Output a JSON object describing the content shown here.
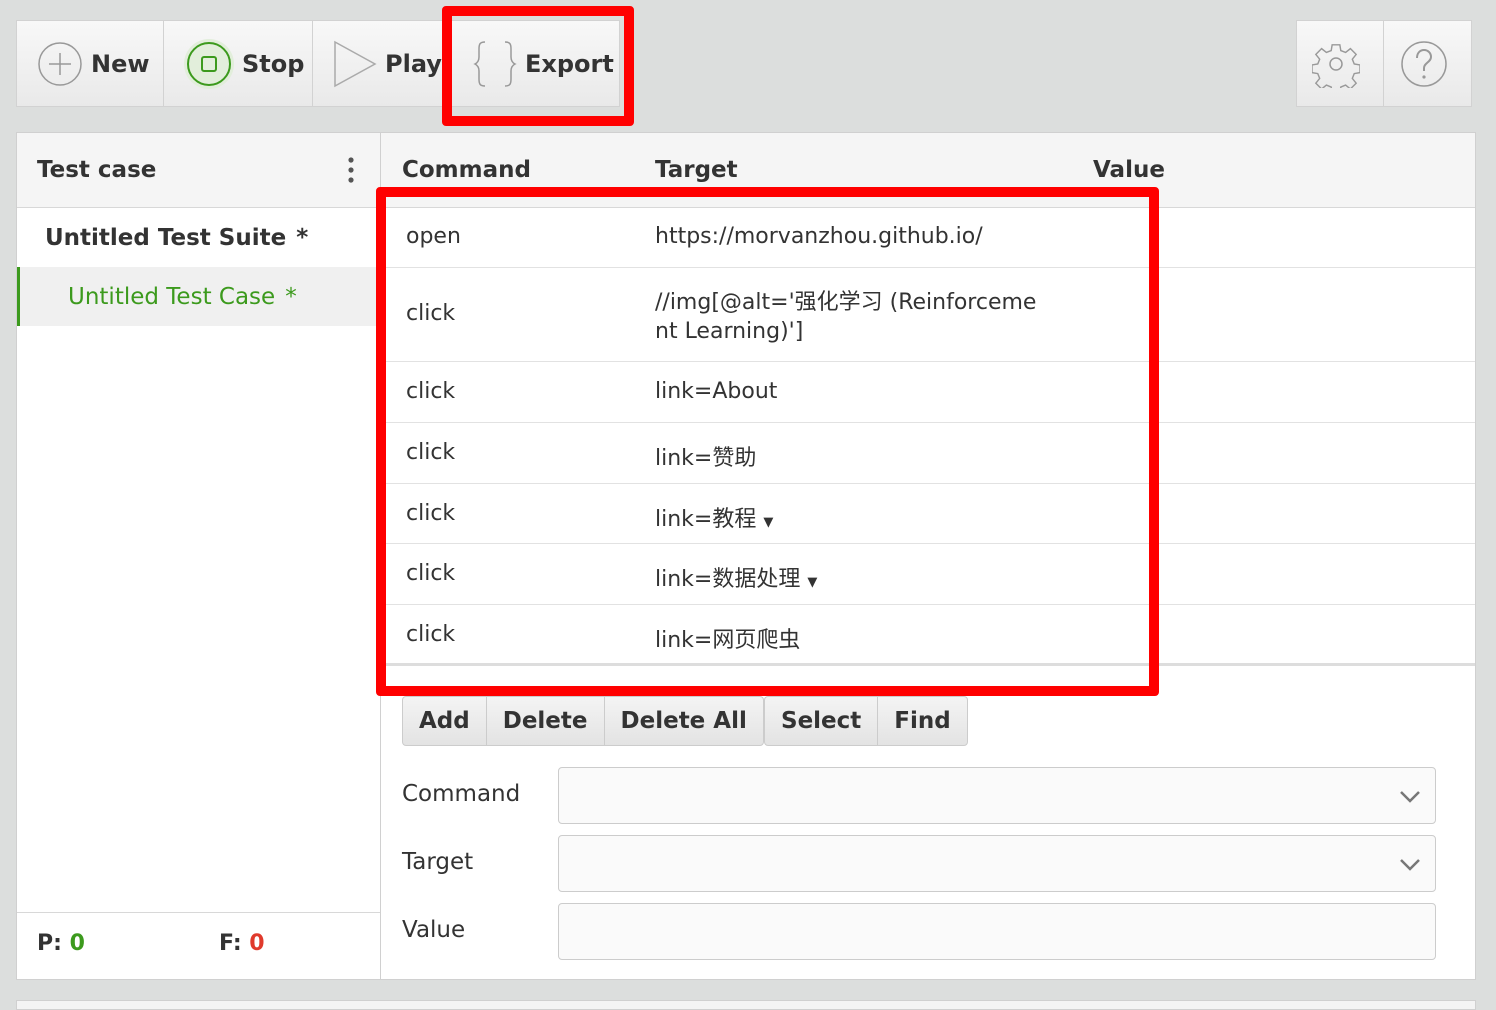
{
  "toolbar": {
    "new": "New",
    "stop": "Stop",
    "play": "Play",
    "export": "Export"
  },
  "sidebar": {
    "header": "Test case",
    "suite": "Untitled Test Suite",
    "suite_mark": "*",
    "case": "Untitled Test Case",
    "case_mark": "*",
    "pass_label": "P:",
    "pass_count": "0",
    "fail_label": "F:",
    "fail_count": "0"
  },
  "table": {
    "headers": [
      "Command",
      "Target",
      "Value"
    ],
    "rows": [
      {
        "command": "open",
        "target": "https://morvanzhou.github.io/",
        "value": ""
      },
      {
        "command": "click",
        "target": "//img[@alt='强化学习 (Reinforceme",
        "target2": "nt Learning)']",
        "value": ""
      },
      {
        "command": "click",
        "target": "link=About",
        "value": ""
      },
      {
        "command": "click",
        "target": "link=赞助",
        "value": ""
      },
      {
        "command": "click",
        "target": "link=教程",
        "value": "",
        "caret": true
      },
      {
        "command": "click",
        "target": "link=数据处理",
        "value": "",
        "caret": true
      },
      {
        "command": "click",
        "target": "link=网页爬虫",
        "value": ""
      }
    ]
  },
  "actions": {
    "add": "Add",
    "delete": "Delete",
    "delete_all": "Delete All",
    "select": "Select",
    "find": "Find"
  },
  "form": {
    "command_label": "Command",
    "target_label": "Target",
    "value_label": "Value",
    "command_value": "",
    "target_value": "",
    "value_value": ""
  },
  "colors": {
    "accent": "#3c9a1d",
    "fail": "#e03a2c",
    "highlight": "#ff0000"
  }
}
